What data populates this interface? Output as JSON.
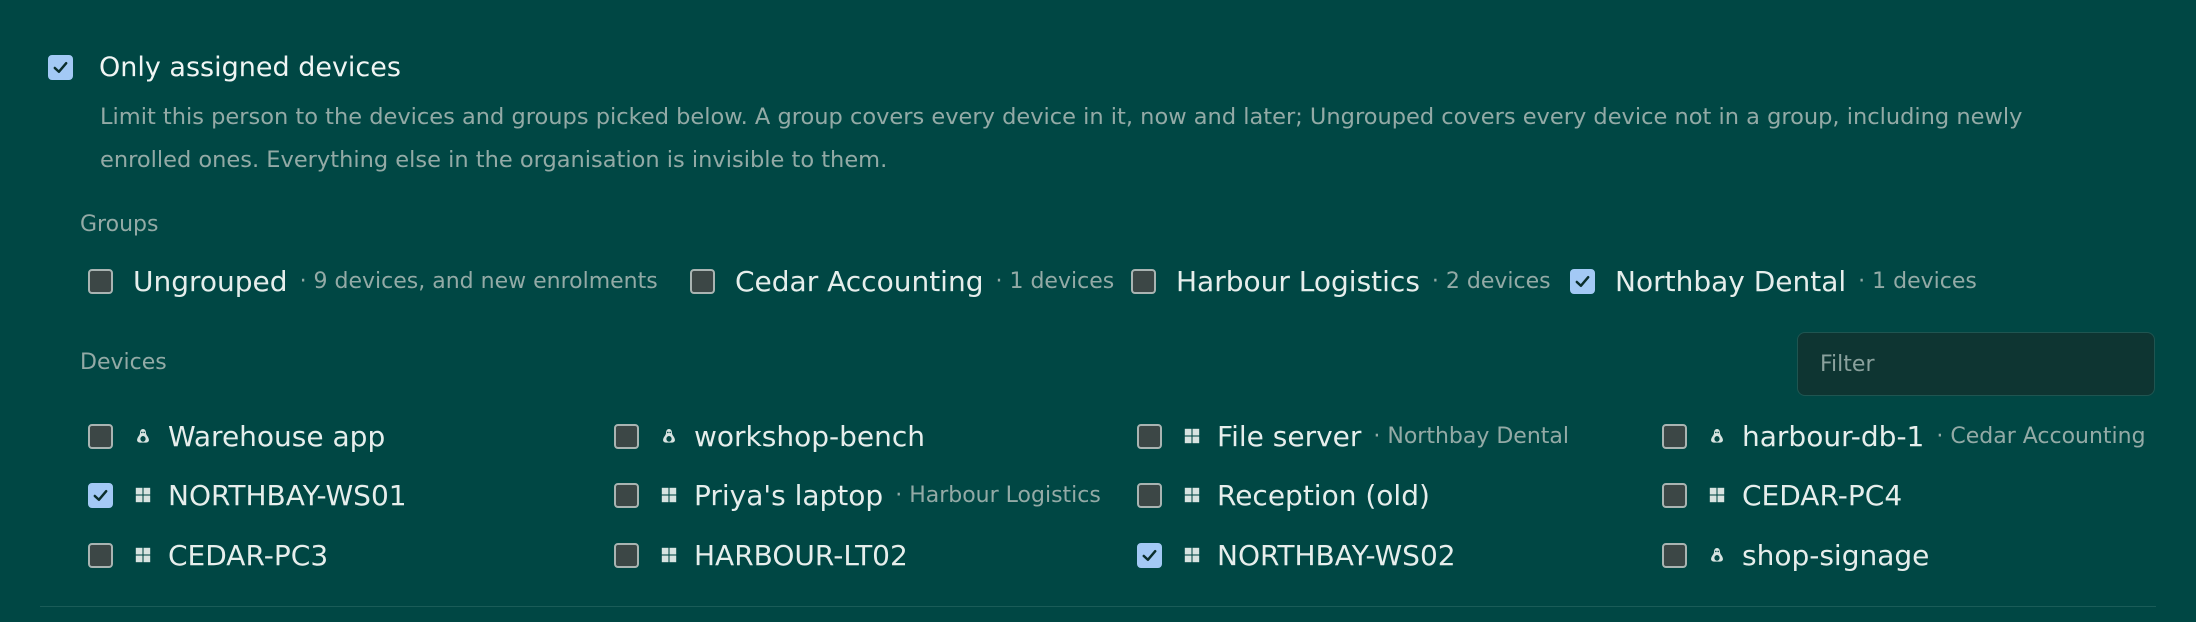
{
  "access": {
    "only_assigned": {
      "label": "Only assigned devices",
      "checked": true
    },
    "help_text": "Limit this person to the devices and groups picked below. A group covers every device in it, now and later; Ungrouped covers every device not in a group, including newly enrolled ones. Everything else in the organisation is invisible to them."
  },
  "groups": {
    "heading": "Groups",
    "items": [
      {
        "name": "Ungrouped",
        "meta": "· 9 devices, and new enrolments",
        "checked": false
      },
      {
        "name": "Cedar Accounting",
        "meta": "· 1 devices",
        "checked": false
      },
      {
        "name": "Harbour Logistics",
        "meta": "· 2 devices",
        "checked": false
      },
      {
        "name": "Northbay Dental",
        "meta": "· 1 devices",
        "checked": true
      }
    ]
  },
  "devices": {
    "heading": "Devices",
    "filter_placeholder": "Filter",
    "items": [
      {
        "name": "Warehouse app",
        "meta": "",
        "os": "linux",
        "checked": false
      },
      {
        "name": "workshop-bench",
        "meta": "",
        "os": "linux",
        "checked": false
      },
      {
        "name": "File server",
        "meta": "· Northbay Dental",
        "os": "windows",
        "checked": false
      },
      {
        "name": "harbour-db-1",
        "meta": "· Cedar Accounting",
        "os": "linux",
        "checked": false
      },
      {
        "name": "NORTHBAY-WS01",
        "meta": "",
        "os": "windows",
        "checked": true
      },
      {
        "name": "Priya's laptop",
        "meta": "· Harbour Logistics",
        "os": "windows",
        "checked": false
      },
      {
        "name": "Reception (old)",
        "meta": "",
        "os": "windows",
        "checked": false
      },
      {
        "name": "CEDAR-PC4",
        "meta": "",
        "os": "windows",
        "checked": false
      },
      {
        "name": "CEDAR-PC3",
        "meta": "",
        "os": "windows",
        "checked": false
      },
      {
        "name": "HARBOUR-LT02",
        "meta": "",
        "os": "windows",
        "checked": false
      },
      {
        "name": "NORTHBAY-WS02",
        "meta": "",
        "os": "windows",
        "checked": true
      },
      {
        "name": "shop-signage",
        "meta": "",
        "os": "linux",
        "checked": false
      }
    ]
  },
  "colors": {
    "background": "#004744",
    "checkbox_checked": "#a3c9f5",
    "checkbox_unchecked": "#3c4746",
    "muted_text": "#93aaa6"
  }
}
